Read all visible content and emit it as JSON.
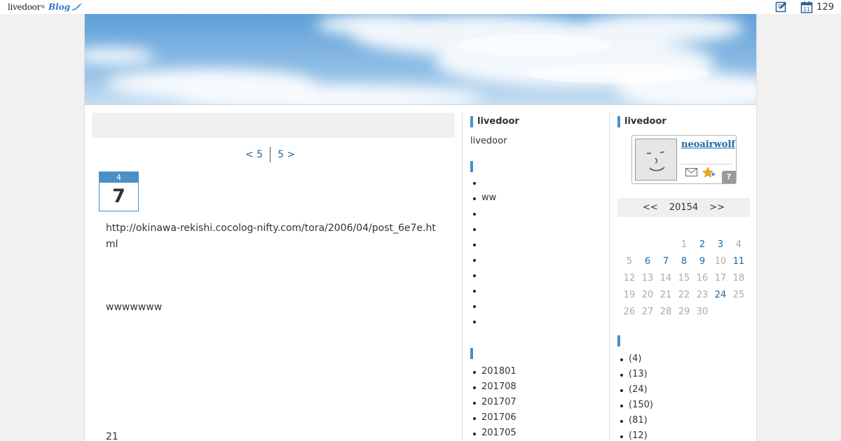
{
  "topbar": {
    "logo_text": "livedoor",
    "logo_reg": "®",
    "logo_blog": "Blog",
    "calendar_icon_day": "11",
    "count": "129"
  },
  "main": {
    "pager_prev": "< 5",
    "pager_next": "5 >",
    "date_month": "4",
    "date_day": "7",
    "entry_url": "http://okinawa-rekishi.cocolog-nifty.com/tora/2006/04/post_6e7e.html",
    "entry_line": "wwwwwww",
    "entry_num": "21"
  },
  "side1": {
    "title1": "livedoor",
    "text1": "livedoor",
    "list1": [
      "",
      "ww",
      "",
      "",
      "",
      "",
      "",
      "",
      "",
      ""
    ],
    "archives": [
      "201801",
      "201708",
      "201707",
      "201706",
      "201705"
    ]
  },
  "side2": {
    "title1": "livedoor",
    "profile_name": "neoairwolf",
    "profile_help": "?",
    "calendar": {
      "prev": "<<",
      "month": "20154",
      "next": ">>",
      "weeks": [
        [
          {
            "d": ""
          },
          {
            "d": ""
          },
          {
            "d": ""
          },
          {
            "d": "1"
          },
          {
            "d": "2",
            "link": true
          },
          {
            "d": "3",
            "link": true
          },
          {
            "d": "4"
          }
        ],
        [
          {
            "d": "5"
          },
          {
            "d": "6",
            "link": true
          },
          {
            "d": "7",
            "link": true
          },
          {
            "d": "8",
            "link": true
          },
          {
            "d": "9",
            "link": true
          },
          {
            "d": "10"
          },
          {
            "d": "11",
            "link": true
          }
        ],
        [
          {
            "d": "12"
          },
          {
            "d": "13"
          },
          {
            "d": "14"
          },
          {
            "d": "15"
          },
          {
            "d": "16"
          },
          {
            "d": "17"
          },
          {
            "d": "18"
          }
        ],
        [
          {
            "d": "19"
          },
          {
            "d": "20"
          },
          {
            "d": "21"
          },
          {
            "d": "22"
          },
          {
            "d": "23"
          },
          {
            "d": "24",
            "link": true
          },
          {
            "d": "25"
          }
        ],
        [
          {
            "d": "26"
          },
          {
            "d": "27"
          },
          {
            "d": "28"
          },
          {
            "d": "29"
          },
          {
            "d": "30"
          },
          {
            "d": ""
          },
          {
            "d": ""
          }
        ]
      ]
    },
    "categories": [
      "(4)",
      "(13)",
      "(24)",
      "(150)",
      "(81)",
      "(12)"
    ]
  },
  "colors": {
    "accent": "#4b8fc4",
    "link": "#1a6aa8",
    "muted_day": "#aaaaaa"
  },
  "icons": [
    "livedoor-blog-logo",
    "edit-icon",
    "calendar-icon",
    "mail-icon",
    "star-plus-icon",
    "help-icon"
  ]
}
